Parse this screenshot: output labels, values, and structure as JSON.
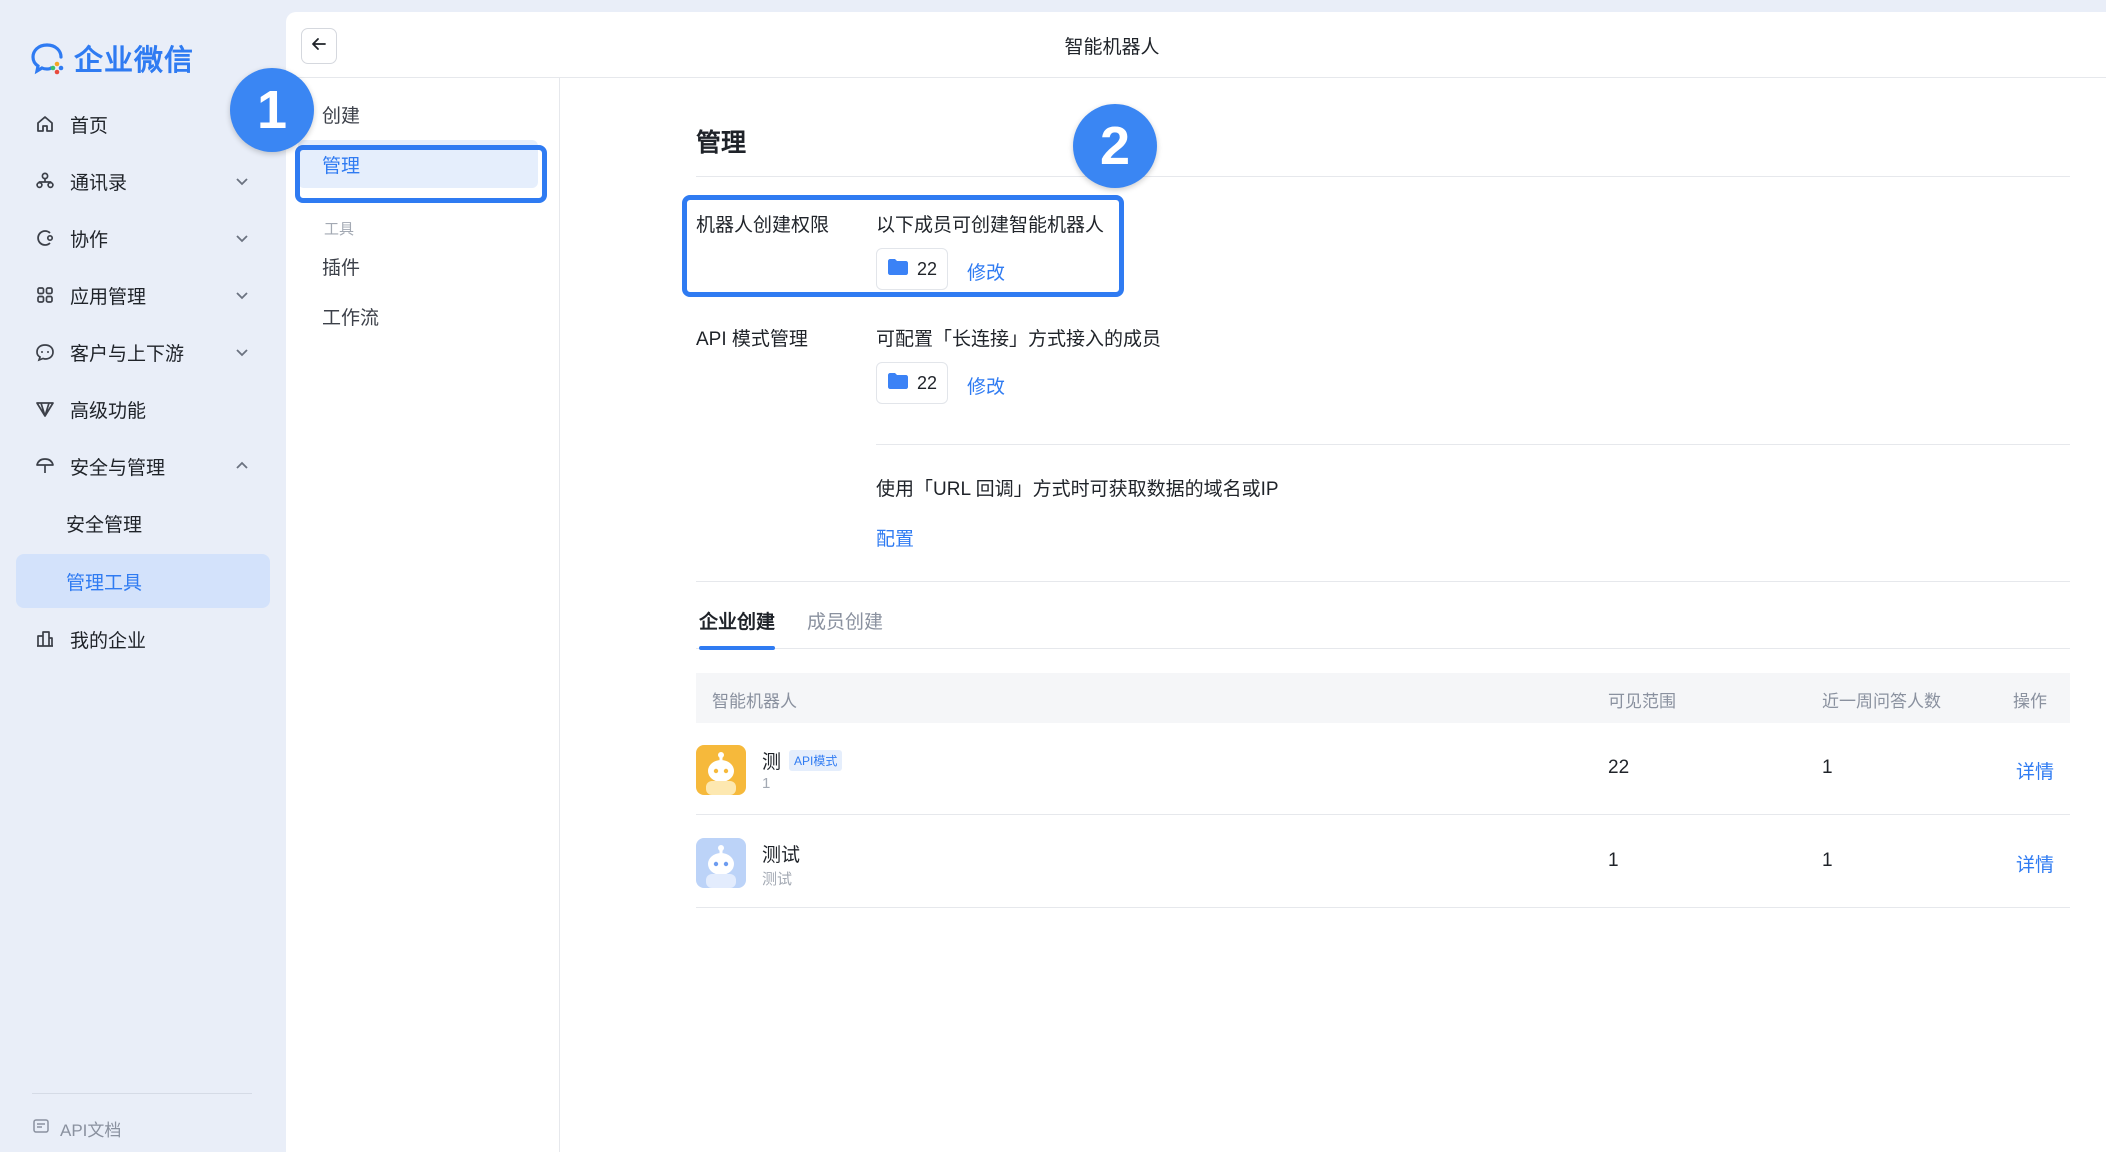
{
  "app": {
    "logo_text": "企业微信"
  },
  "nav": {
    "items": [
      {
        "label": "首页",
        "icon": "home-icon"
      },
      {
        "label": "通讯录",
        "icon": "contacts-icon"
      },
      {
        "label": "协作",
        "icon": "collaboration-icon"
      },
      {
        "label": "应用管理",
        "icon": "apps-grid-icon"
      },
      {
        "label": "客户与上下游",
        "icon": "chat-bubble-icon"
      },
      {
        "label": "高级功能",
        "icon": "diamond-icon"
      },
      {
        "label": "安全与管理",
        "icon": "umbrella-icon"
      },
      {
        "label": "安全管理"
      },
      {
        "label": "管理工具"
      },
      {
        "label": "我的企业",
        "icon": "building-icon"
      }
    ],
    "footer": "API文档"
  },
  "topbar": {
    "title": "智能机器人"
  },
  "submenu": {
    "create": "创建",
    "manage": "管理",
    "tools_group": "工具",
    "plugins": "插件",
    "workflow": "工作流"
  },
  "content": {
    "title": "管理",
    "create_permission": {
      "label": "机器人创建权限",
      "desc": "以下成员可创建智能机器人",
      "count": "22",
      "edit": "修改"
    },
    "api_mode": {
      "label": "API 模式管理",
      "desc": "可配置「长连接」方式接入的成员",
      "count": "22",
      "edit": "修改",
      "url_desc": "使用「URL 回调」方式时可获取数据的域名或IP",
      "config": "配置"
    },
    "tabs": [
      "企业创建",
      "成员创建"
    ],
    "table": {
      "headers": [
        "智能机器人",
        "可见范围",
        "近一周问答人数",
        "操作"
      ],
      "rows": [
        {
          "name": "测",
          "tag": "API模式",
          "sub": "1",
          "scope": "22",
          "weekly": "1",
          "action": "详情"
        },
        {
          "name": "测试",
          "tag": "",
          "sub": "测试",
          "scope": "1",
          "weekly": "1",
          "action": "详情"
        }
      ]
    }
  },
  "markers": [
    "1",
    "2"
  ],
  "colors": {
    "accent": "#2f7bf2",
    "nav_bg": "#e9eef8",
    "active_bg": "#d3e2fb"
  }
}
